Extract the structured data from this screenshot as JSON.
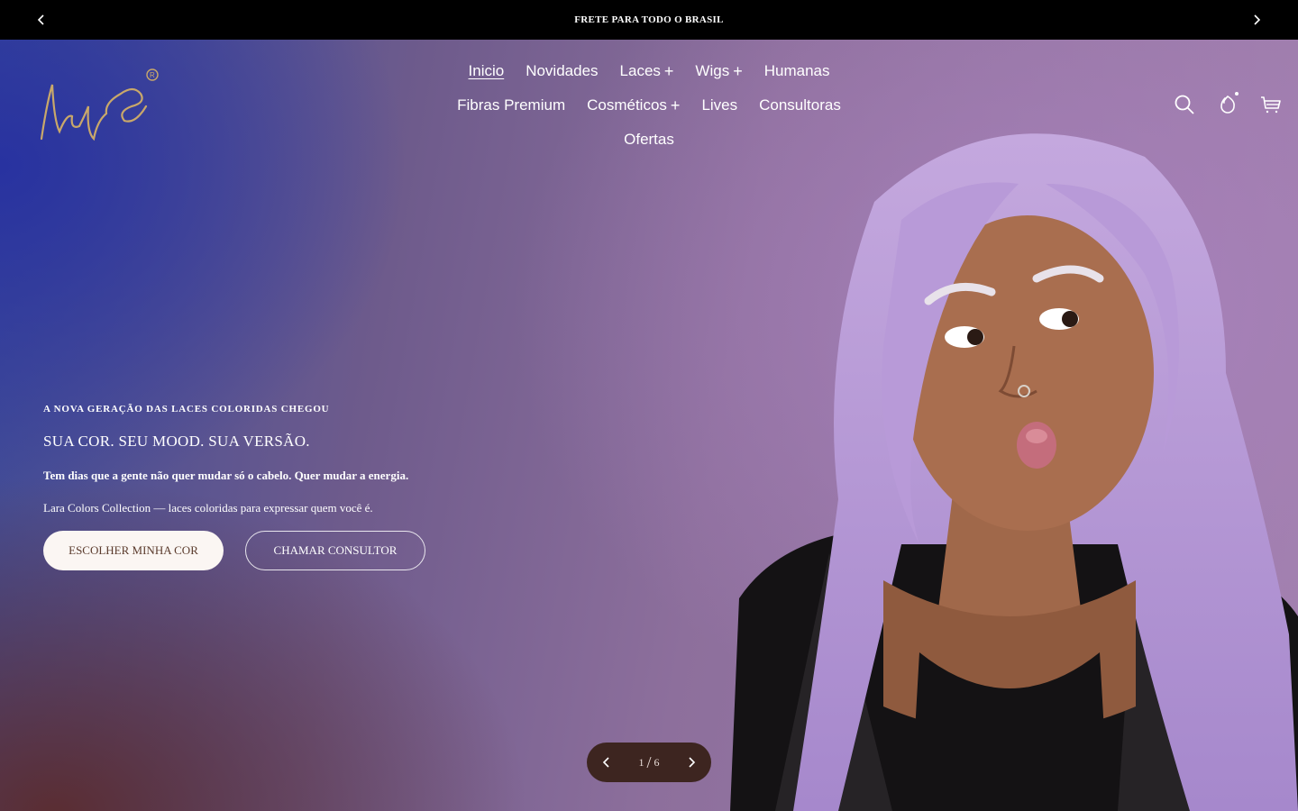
{
  "announcement": {
    "text": "FRETE PARA TODO O BRASIL"
  },
  "header": {
    "logo_text": "lady laces",
    "nav": {
      "row1": [
        {
          "label": "Inicio",
          "active": true,
          "has_submenu": false
        },
        {
          "label": "Novidades",
          "has_submenu": false
        },
        {
          "label": "Laces",
          "has_submenu": true
        },
        {
          "label": "Wigs",
          "has_submenu": true
        },
        {
          "label": "Humanas",
          "has_submenu": false
        }
      ],
      "row2": [
        {
          "label": "Fibras Premium",
          "has_submenu": false
        },
        {
          "label": "Cosméticos",
          "has_submenu": true
        },
        {
          "label": "Lives",
          "has_submenu": false
        },
        {
          "label": "Consultoras",
          "has_submenu": false
        }
      ],
      "row3": [
        {
          "label": "Ofertas",
          "has_submenu": false
        }
      ]
    },
    "icons": [
      "search-icon",
      "account-icon",
      "cart-icon"
    ]
  },
  "hero": {
    "eyebrow": "A NOVA GERAÇÃO DAS LACES COLORIDAS CHEGOU",
    "headline": "SUA COR. SEU MOOD. SUA VERSÃO.",
    "bold_line": "Tem dias que a gente não quer mudar só o cabelo. Quer mudar a energia.",
    "description": "Lara Colors Collection — laces coloridas para expressar quem você é.",
    "primary_button": "ESCOLHER MINHA COR",
    "secondary_button": "CHAMAR CONSULTOR"
  },
  "slider": {
    "current": "1",
    "total": "6",
    "separator": "/"
  },
  "colors": {
    "announcement_bg": "#000000",
    "hair_lavender": "#b79bd6",
    "pager_bg": "#3d2520",
    "primary_button_bg": "#fbf6f3",
    "logo_gold": "#c9a86a"
  }
}
